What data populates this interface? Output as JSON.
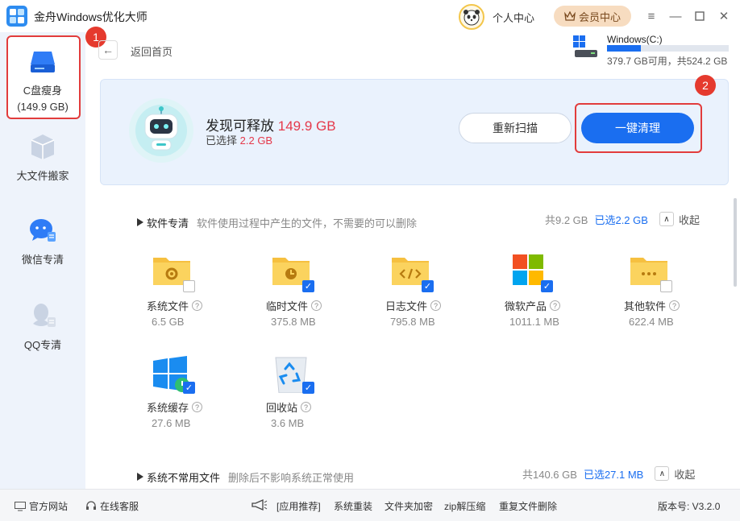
{
  "app": {
    "title": "金舟Windows优化大师"
  },
  "header": {
    "user_center": "个人中心",
    "vip": "会员中心"
  },
  "sidebar": {
    "items": [
      {
        "label": "C盘瘦身",
        "sub": "(149.9 GB)"
      },
      {
        "label": "大文件搬家"
      },
      {
        "label": "微信专清"
      },
      {
        "label": "QQ专清"
      }
    ]
  },
  "annotations": {
    "step1": "1",
    "step2": "2"
  },
  "nav": {
    "back": "返回首页"
  },
  "drive": {
    "name": "Windows(C:)",
    "info": "379.7 GB可用，共524.2 GB",
    "used_fraction": 0.28
  },
  "summary": {
    "found_prefix": "发现可释放",
    "found_value": "149.9 GB",
    "selected_prefix": "已选择",
    "selected_value": "2.2 GB",
    "rescan": "重新扫描",
    "clean": "一键清理"
  },
  "sections": [
    {
      "title": "软件专清",
      "desc": "软件使用过程中产生的文件，不需要的可以删除",
      "total": "共9.2 GB",
      "selected": "已选2.2 GB",
      "collapse": "收起",
      "items": [
        {
          "name": "系统文件",
          "size": "6.5 GB",
          "checked": false,
          "icon": "gear-folder-icon"
        },
        {
          "name": "临时文件",
          "size": "375.8 MB",
          "checked": true,
          "icon": "clock-folder-icon"
        },
        {
          "name": "日志文件",
          "size": "795.8 MB",
          "checked": true,
          "icon": "code-folder-icon"
        },
        {
          "name": "微软产品",
          "size": "1011.1 MB",
          "checked": true,
          "icon": "microsoft-logo-icon"
        },
        {
          "name": "其他软件",
          "size": "622.4 MB",
          "checked": false,
          "icon": "dots-folder-icon"
        },
        {
          "name": "系统缓存",
          "size": "27.6 MB",
          "checked": true,
          "icon": "windows-logo-icon"
        },
        {
          "name": "回收站",
          "size": "3.6 MB",
          "checked": true,
          "icon": "recycle-bin-icon"
        }
      ]
    },
    {
      "title": "系统不常用文件",
      "desc": "删除后不影响系统正常使用",
      "total": "共140.6 GB",
      "selected": "已选27.1 MB",
      "collapse": "收起"
    }
  ],
  "footer": {
    "website": "官方网站",
    "service": "在线客服",
    "apps": "[应用推荐]",
    "reinstall": "系统重装",
    "encrypt": "文件夹加密",
    "zip": "zip解压缩",
    "dup": "重复文件删除",
    "version": "版本号: V3.2.0"
  },
  "colors": {
    "accent": "#1a6ef0",
    "highlight": "#e5394b",
    "annotation": "#e23c3c"
  }
}
